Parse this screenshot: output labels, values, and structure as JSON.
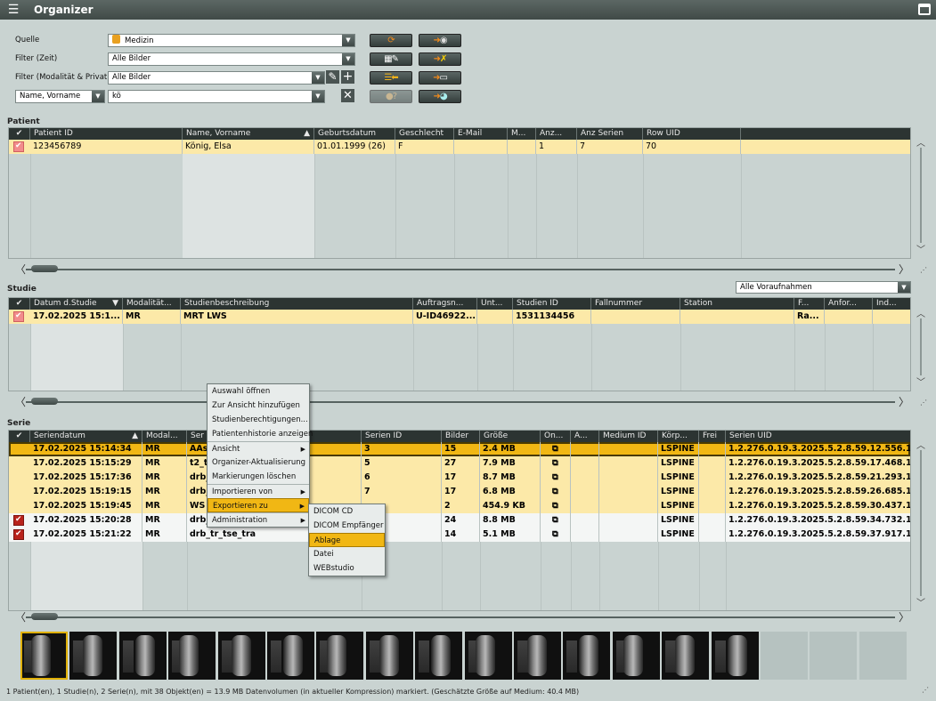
{
  "window": {
    "title": "Organizer"
  },
  "filters": {
    "quelle_label": "Quelle",
    "quelle_value": "Medizin",
    "zeit_label": "Filter (Zeit)",
    "zeit_value": "Alle Bilder",
    "modal_label": "Filter (Modalität & Privat)",
    "modal_value": "Alle Bilder",
    "search_field": "Name, Vorname",
    "search_value": "kö"
  },
  "patient": {
    "section_label": "Patient",
    "columns": [
      "Patient ID",
      "Name, Vorname",
      "Geburtsdatum",
      "Geschlecht",
      "E-Mail",
      "M...",
      "Anz...",
      "Anz Serien",
      "Row UID"
    ],
    "row": [
      "123456789",
      "König, Elsa",
      "01.01.1999 (26)",
      "F",
      "",
      "",
      "1",
      "7",
      "70"
    ]
  },
  "study": {
    "section_label": "Studie",
    "dropdown": "Alle Voraufnahmen",
    "columns": [
      "Datum d.Studie",
      "Modalität...",
      "Studienbeschreibung",
      "Auftragsn...",
      "Unt...",
      "Studien ID",
      "Fallnummer",
      "Station",
      "F...",
      "Anfor...",
      "Ind..."
    ],
    "row": [
      "17.02.2025 15:1...",
      "MR",
      "MRT LWS",
      "U-ID46922...",
      "",
      "1531134456",
      "",
      "",
      "Ra...",
      "",
      ""
    ]
  },
  "series": {
    "section_label": "Serie",
    "columns": [
      "Seriendatum",
      "Modal...",
      "Ser",
      "Serien ID",
      "Bilder",
      "Größe",
      "On...",
      "A...",
      "Medium ID",
      "Körp...",
      "Frei",
      "Serien UID"
    ],
    "rows": [
      {
        "date": "17.02.2025 15:14:34",
        "mod": "MR",
        "desc": "AAs",
        "id": "3",
        "images": "15",
        "size": "2.4 MB",
        "body": "LSPINE",
        "uid": "1.2.276.0.19.3.2025.5.2.8.59.12.556.1",
        "checked": false,
        "selected": true
      },
      {
        "date": "17.02.2025 15:15:29",
        "mod": "MR",
        "desc": "t2_t",
        "id": "5",
        "images": "27",
        "size": "7.9 MB",
        "body": "LSPINE",
        "uid": "1.2.276.0.19.3.2025.5.2.8.59.17.468.1",
        "checked": false,
        "selected": false
      },
      {
        "date": "17.02.2025 15:17:36",
        "mod": "MR",
        "desc": "drb_",
        "id": "6",
        "images": "17",
        "size": "8.7 MB",
        "body": "LSPINE",
        "uid": "1.2.276.0.19.3.2025.5.2.8.59.21.293.1",
        "checked": false,
        "selected": false
      },
      {
        "date": "17.02.2025 15:19:15",
        "mod": "MR",
        "desc": "drb_",
        "id": "7",
        "images": "17",
        "size": "6.8 MB",
        "body": "LSPINE",
        "uid": "1.2.276.0.19.3.2025.5.2.8.59.26.685.1",
        "checked": false,
        "selected": false
      },
      {
        "date": "17.02.2025 15:19:45",
        "mod": "MR",
        "desc": "WS",
        "id": "",
        "images": "2",
        "size": "454.9 KB",
        "body": "LSPINE",
        "uid": "1.2.276.0.19.3.2025.5.2.8.59.30.437.1",
        "checked": false,
        "selected": false
      },
      {
        "date": "17.02.2025 15:20:28",
        "mod": "MR",
        "desc": "drb_",
        "id": "",
        "images": "24",
        "size": "8.8 MB",
        "body": "LSPINE",
        "uid": "1.2.276.0.19.3.2025.5.2.8.59.34.732.1",
        "checked": true,
        "selected": false
      },
      {
        "date": "17.02.2025 15:21:22",
        "mod": "MR",
        "desc": "drb_tr_tse_tra",
        "id": "",
        "images": "14",
        "size": "5.1 MB",
        "body": "LSPINE",
        "uid": "1.2.276.0.19.3.2025.5.2.8.59.37.917.1",
        "checked": true,
        "selected": false
      }
    ]
  },
  "context_menu": {
    "items": [
      {
        "label": "Auswahl öffnen",
        "sub": false,
        "sep": false
      },
      {
        "label": "Zur Ansicht hinzufügen",
        "sub": false,
        "sep": false
      },
      {
        "label": "Studienberechtigungen...",
        "sub": false,
        "sep": false
      },
      {
        "label": "Patientenhistorie anzeigen",
        "sub": false,
        "sep": false
      },
      {
        "label": "Ansicht",
        "sub": true,
        "sep": true
      },
      {
        "label": "Organizer-Aktualisierung",
        "sub": false,
        "sep": false
      },
      {
        "label": "Markierungen löschen",
        "sub": false,
        "sep": false
      },
      {
        "label": "Importieren von",
        "sub": true,
        "sep": true
      },
      {
        "label": "Exportieren zu",
        "sub": true,
        "sep": false,
        "highlight": true
      },
      {
        "label": "Administration",
        "sub": true,
        "sep": true
      }
    ],
    "submenu": [
      "DICOM CD",
      "DICOM Empfänger",
      "Ablage",
      "Datei",
      "WEBstudio"
    ],
    "submenu_highlight": "Ablage"
  },
  "thumbnails": {
    "filled": 15,
    "empty": 3
  },
  "status_bar": "1 Patient(en), 1 Studie(n), 2 Serie(n), mit 38 Objekt(en) = 13.9 MB Datenvolumen (in aktueller Kompression) markiert. (Geschätzte Größe auf Medium: 40.4 MB)",
  "colors": {
    "accent": "#f1b714",
    "selected_row": "#fce9a8",
    "header": "#2c3432",
    "checked": "#b8231c"
  }
}
